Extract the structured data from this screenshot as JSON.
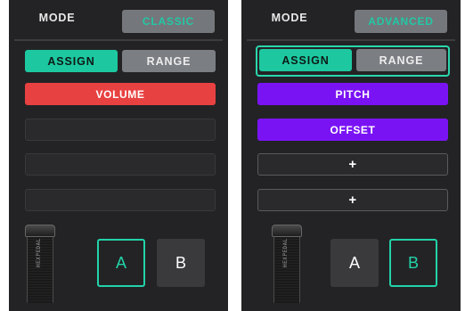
{
  "left": {
    "mode_label": "MODE",
    "mode_value": "CLASSIC",
    "assign_label": "ASSIGN",
    "range_label": "RANGE",
    "slots": [
      "VOLUME",
      "",
      "",
      ""
    ],
    "pedal_text": "HEXPEDAL",
    "a_label": "A",
    "b_label": "B",
    "active_footswitch": "A"
  },
  "right": {
    "mode_label": "MODE",
    "mode_value": "ADVANCED",
    "assign_label": "ASSIGN",
    "range_label": "RANGE",
    "slots": [
      "PITCH",
      "OFFSET",
      "+",
      "+"
    ],
    "pedal_text": "HEXPEDAL",
    "a_label": "A",
    "b_label": "B",
    "active_footswitch": "B"
  },
  "colors": {
    "panel_bg": "#232325",
    "accent": "#22d3a9",
    "volume_slot": "#e84141",
    "pitch_slot": "#7a13f4"
  }
}
